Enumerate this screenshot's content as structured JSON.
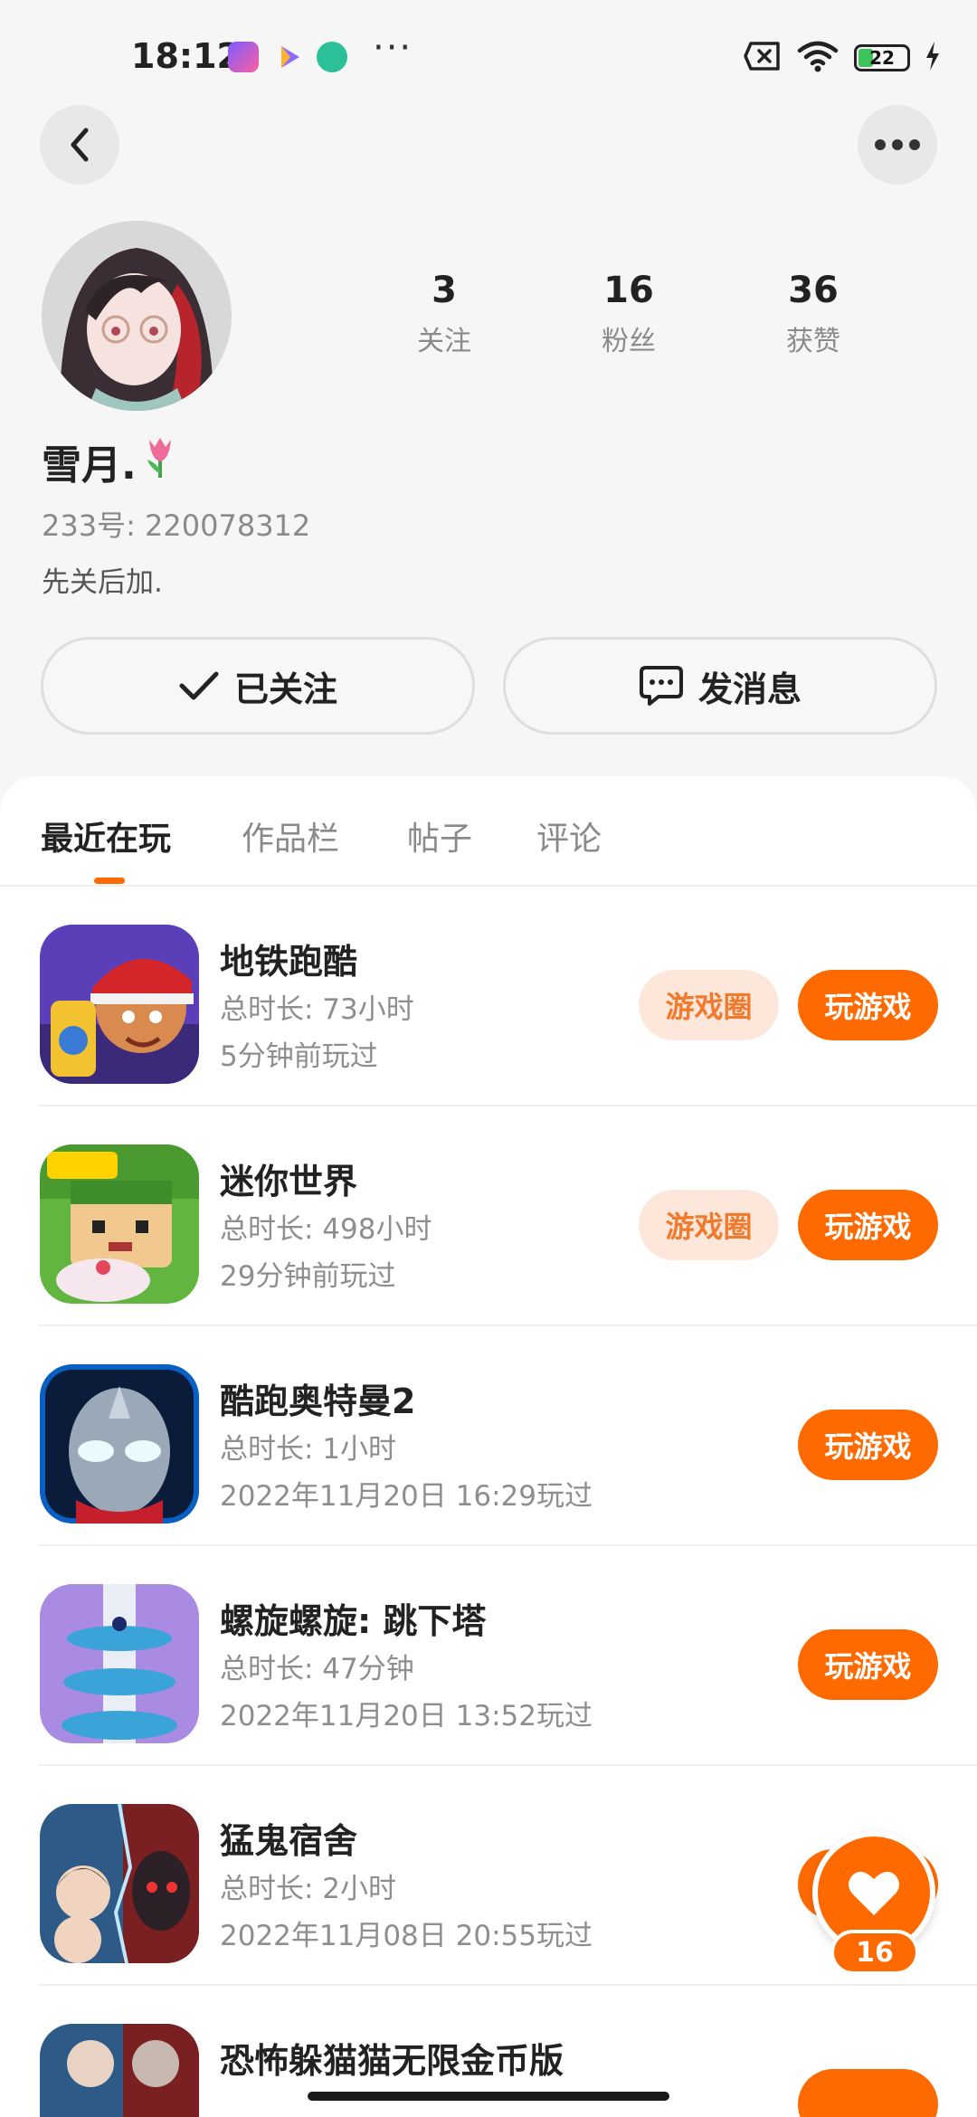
{
  "status_bar": {
    "time": "18:12",
    "dots": "···",
    "battery": "22"
  },
  "profile": {
    "stats": [
      {
        "value": "3",
        "label": "关注"
      },
      {
        "value": "16",
        "label": "粉丝"
      },
      {
        "value": "36",
        "label": "获赞"
      }
    ],
    "username": "雪月.",
    "id_line": "233号: 220078312",
    "bio": "先关后加.",
    "follow_label": "已关注",
    "message_label": "发消息"
  },
  "tabs": [
    {
      "label": "最近在玩",
      "active": true
    },
    {
      "label": "作品栏",
      "active": false
    },
    {
      "label": "帖子",
      "active": false
    },
    {
      "label": "评论",
      "active": false
    }
  ],
  "games": [
    {
      "name": "地铁跑酷",
      "duration": "总时长: 73小时",
      "last_played": "5分钟前玩过",
      "circle_label": "游戏圈",
      "play_label": "玩游戏"
    },
    {
      "name": "迷你世界",
      "duration": "总时长: 498小时",
      "last_played": "29分钟前玩过",
      "circle_label": "游戏圈",
      "play_label": "玩游戏"
    },
    {
      "name": "酷跑奥特曼2",
      "duration": "总时长: 1小时",
      "last_played": "2022年11月20日 16:29玩过",
      "play_label": "玩游戏"
    },
    {
      "name": "螺旋螺旋: 跳下塔",
      "duration": "总时长: 47分钟",
      "last_played": "2022年11月20日 13:52玩过",
      "play_label": "玩游戏"
    },
    {
      "name": "猛鬼宿舍",
      "duration": "总时长: 2小时",
      "last_played": "2022年11月08日 20:55玩过",
      "play_label": ""
    },
    {
      "name": "恐怖躲猫猫无限金币版",
      "duration": "",
      "last_played": "",
      "play_label": ""
    }
  ],
  "like_count": "16",
  "colors": {
    "accent": "#ff6a00",
    "accent_soft": "#fde7da",
    "text_muted": "#8a8a8a"
  }
}
